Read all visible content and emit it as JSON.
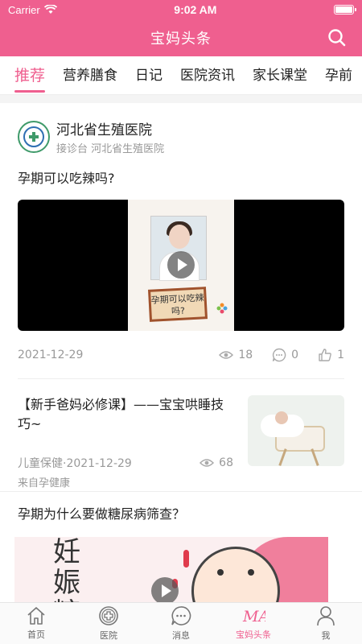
{
  "status": {
    "carrier": "Carrier",
    "time": "9:02 AM"
  },
  "header": {
    "title": "宝妈头条"
  },
  "tabs": [
    {
      "label": "推荐",
      "active": true
    },
    {
      "label": "营养膳食"
    },
    {
      "label": "日记"
    },
    {
      "label": "医院资讯"
    },
    {
      "label": "家长课堂"
    },
    {
      "label": "孕前"
    }
  ],
  "post1": {
    "author": "河北省生殖医院",
    "author_sub": "接诊台 河北省生殖医院",
    "question": "孕期可以吃辣吗?",
    "poster_sign": "孕期可以吃辣吗?",
    "date": "2021-12-29",
    "views": "18",
    "comments": "0",
    "likes": "1"
  },
  "article": {
    "title": "【新手爸妈必修课】——宝宝哄睡技巧~",
    "category_date": "儿童保健·2021-12-29",
    "views": "68",
    "source": "来自孕健康"
  },
  "post2": {
    "question": "孕期为什么要做糖尿病筛查？",
    "cartoon_text": "妊娠糖"
  },
  "bottom_nav": [
    {
      "label": "首页",
      "icon": "home-icon"
    },
    {
      "label": "医院",
      "icon": "hospital-icon"
    },
    {
      "label": "消息",
      "icon": "message-icon"
    },
    {
      "label": "宝妈头条",
      "icon": "ma-icon",
      "active": true
    },
    {
      "label": "我",
      "icon": "profile-icon"
    }
  ],
  "colors": {
    "accent": "#ef5f8f"
  }
}
